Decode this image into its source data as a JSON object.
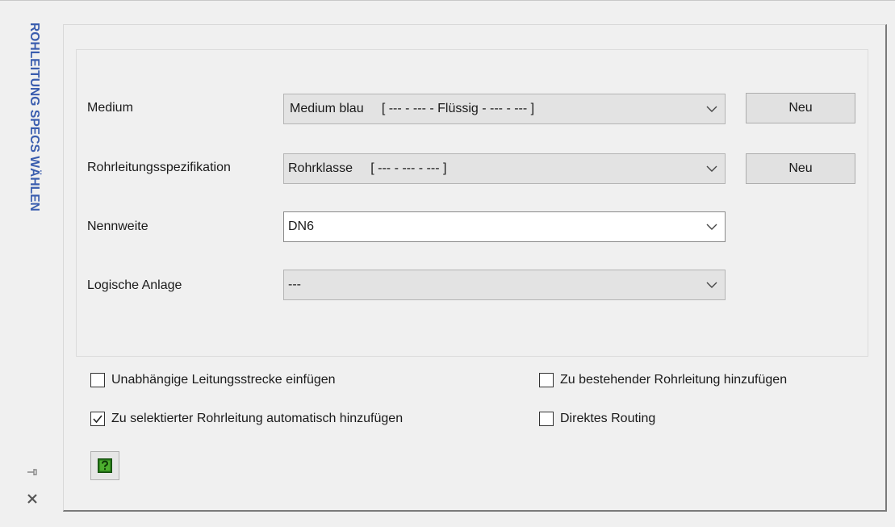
{
  "sidebar": {
    "title": "ROHLEITUNG SPECS WÄHLEN",
    "pin_icon": "pin-icon",
    "close_icon": "close-icon",
    "title_color": "#3a5dae"
  },
  "form": {
    "medium": {
      "label": "Medium",
      "value": "Medium blau     [ --- - --- - Flüssig - --- - --- ]",
      "new_button": "Neu"
    },
    "spec": {
      "label": "Rohrleitungsspezifikation",
      "value": "Rohrklasse     [ --- - --- - --- ]",
      "new_button": "Neu"
    },
    "nominal": {
      "label": "Nennweite",
      "value": "DN6"
    },
    "plant": {
      "label": "Logische Anlage",
      "value": "---"
    }
  },
  "options": {
    "independent_run": {
      "label": "Unabhängige Leitungsstrecke einfügen",
      "checked": false
    },
    "add_selected": {
      "label": "Zu selektierter Rohrleitung automatisch hinzufügen",
      "checked": true
    },
    "add_existing": {
      "label": "Zu bestehender Rohrleitung hinzufügen",
      "checked": false
    },
    "direct_routing": {
      "label": "Direktes Routing",
      "checked": false
    }
  },
  "help": {
    "icon": "help-icon",
    "accent": "#3a9b2a"
  }
}
